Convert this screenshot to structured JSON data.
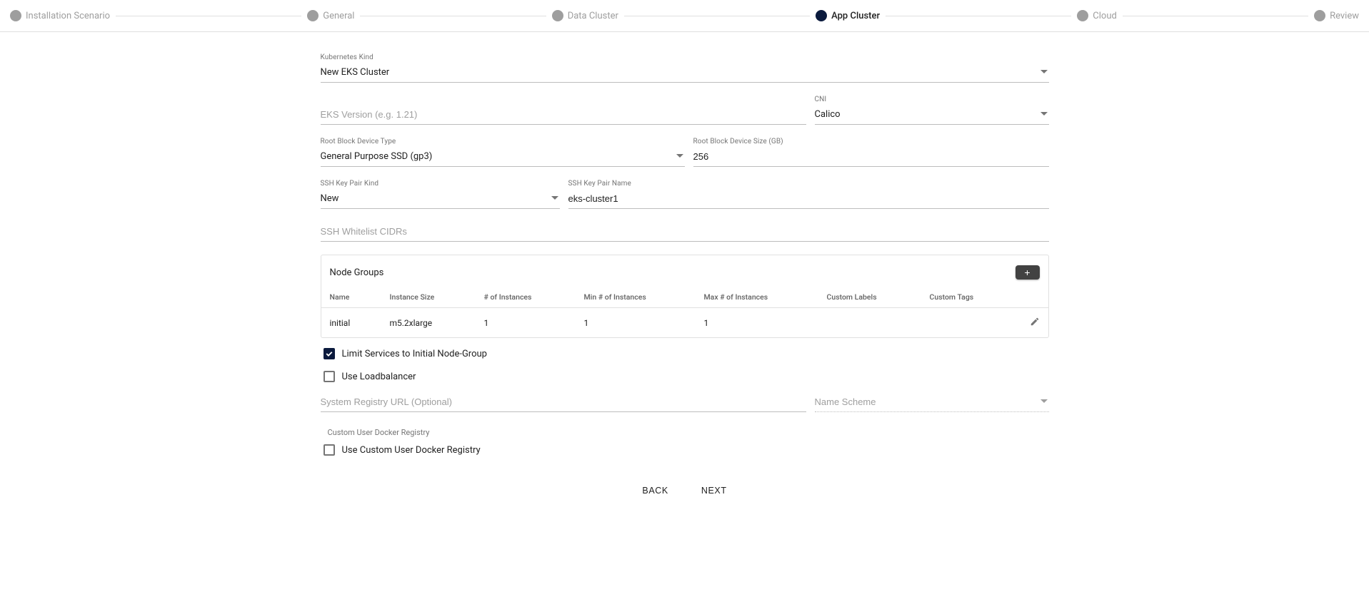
{
  "stepper": {
    "steps": [
      {
        "label": "Installation Scenario",
        "active": false
      },
      {
        "label": "General",
        "active": false
      },
      {
        "label": "Data Cluster",
        "active": false
      },
      {
        "label": "App Cluster",
        "active": true
      },
      {
        "label": "Cloud",
        "active": false
      },
      {
        "label": "Review",
        "active": false
      }
    ]
  },
  "form": {
    "kubernetes_kind": {
      "label": "Kubernetes Kind",
      "value": "New EKS Cluster"
    },
    "eks_version": {
      "placeholder": "EKS Version (e.g. 1.21)",
      "value": ""
    },
    "cni": {
      "label": "CNI",
      "value": "Calico"
    },
    "root_block_type": {
      "label": "Root Block Device Type",
      "value": "General Purpose SSD (gp3)"
    },
    "root_block_size": {
      "label": "Root Block Device Size (GB)",
      "value": "256"
    },
    "ssh_kind": {
      "label": "SSH Key Pair Kind",
      "value": "New"
    },
    "ssh_name": {
      "label": "SSH Key Pair Name",
      "value": "eks-cluster1"
    },
    "ssh_cidrs": {
      "placeholder": "SSH Whitelist CIDRs",
      "value": ""
    },
    "limit_services": {
      "label": "Limit Services to Initial Node-Group",
      "checked": true
    },
    "use_lb": {
      "label": "Use Loadbalancer",
      "checked": false
    },
    "registry_url": {
      "placeholder": "System Registry URL (Optional)",
      "value": ""
    },
    "name_scheme": {
      "placeholder": "Name Scheme",
      "value": ""
    },
    "custom_registry_section": "Custom User Docker Registry",
    "use_custom_registry": {
      "label": "Use Custom User Docker Registry",
      "checked": false
    }
  },
  "node_groups": {
    "title": "Node Groups",
    "headers": [
      "Name",
      "Instance Size",
      "# of Instances",
      "Min # of Instances",
      "Max # of Instances",
      "Custom Labels",
      "Custom Tags",
      ""
    ],
    "rows": [
      {
        "name": "initial",
        "instance_size": "m5.2xlarge",
        "count": "1",
        "min": "1",
        "max": "1",
        "labels": "",
        "tags": ""
      }
    ]
  },
  "footer": {
    "back": "BACK",
    "next": "NEXT"
  }
}
